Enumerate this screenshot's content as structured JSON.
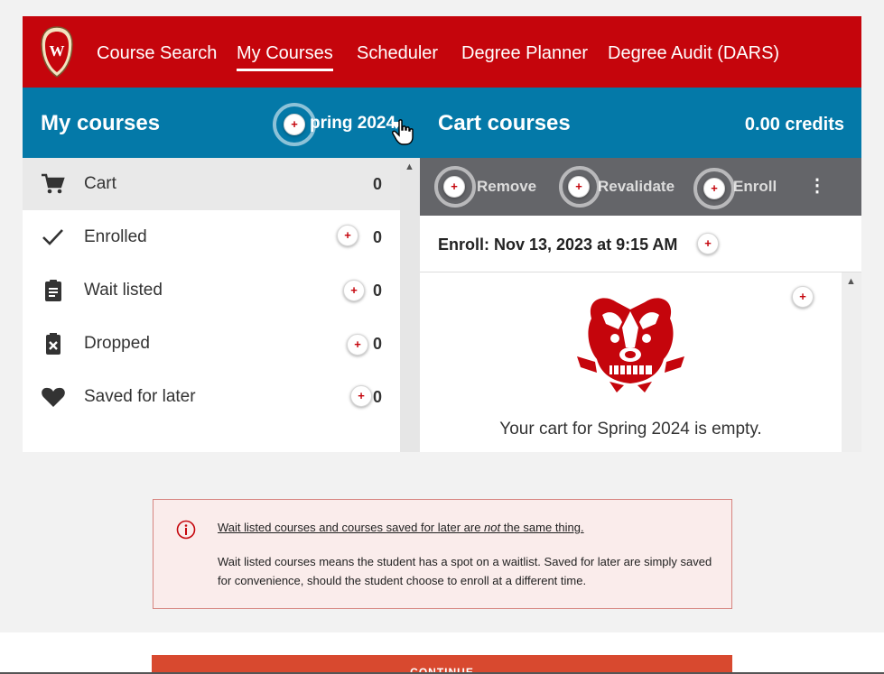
{
  "nav": {
    "items": [
      {
        "label": "Course Search"
      },
      {
        "label": "My Courses",
        "active": true
      },
      {
        "label": "Scheduler"
      },
      {
        "label": "Degree Planner"
      },
      {
        "label": "Degree Audit (DARS)"
      }
    ]
  },
  "my_courses": {
    "title": "My courses",
    "term": "pring 2024",
    "list": [
      {
        "label": "Cart",
        "count": "0",
        "icon": "cart-icon",
        "selected": true
      },
      {
        "label": "Enrolled",
        "count": "0",
        "icon": "checkmark-icon"
      },
      {
        "label": "Wait listed",
        "count": "0",
        "icon": "clipboard-icon"
      },
      {
        "label": "Dropped",
        "count": "0",
        "icon": "dropped-icon"
      },
      {
        "label": "Saved for later",
        "count": "0",
        "icon": "heart-icon"
      }
    ]
  },
  "cart": {
    "title": "Cart courses",
    "credits": "0.00 credits",
    "actions": {
      "remove": "Remove",
      "revalidate": "Revalidate",
      "enroll": "Enroll"
    },
    "enroll_date": "Enroll: Nov 13, 2023 at 9:15 AM",
    "empty_message": "Your cart for Spring 2024 is empty."
  },
  "hotspot_symbol": "+",
  "note": {
    "heading_before": "Wait listed courses and courses saved for later are ",
    "heading_em": "not",
    "heading_after": " the same thing.",
    "body": "Wait listed courses means the student has a spot on a waitlist. Saved for later are simply saved for convenience, should the student choose to enroll at a different time."
  },
  "continue_label": "CONTINUE",
  "colors": {
    "brand_red": "#c5050c",
    "header_blue": "#0479a8",
    "action_bar": "#646569",
    "note_bg": "#faeceb",
    "continue_button": "#d8492f"
  }
}
